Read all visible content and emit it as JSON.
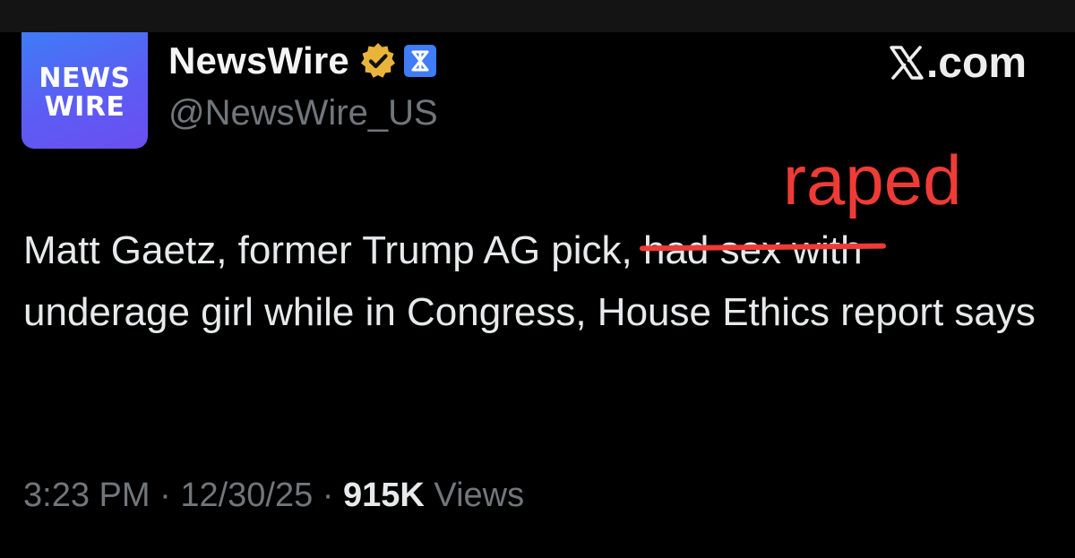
{
  "colors": {
    "background": "#000000",
    "primary_text": "#e7e9ea",
    "secondary_text": "#71767b",
    "annotation_red": "#ef3b36",
    "verified_gold": "#e8b53a",
    "affiliate_blue": "#3f7cf6"
  },
  "avatar": {
    "line1": "NEWS",
    "line2": "WIRE"
  },
  "author": {
    "display_name": "NewsWire",
    "handle": "@NewsWire_US",
    "verified_icon": "gold-verified-badge-icon",
    "affiliate_icon": "affiliate-badge-icon"
  },
  "source": {
    "logo_icon": "x-logo-icon",
    "suffix": ".com"
  },
  "annotation": {
    "replacement_text": "raped"
  },
  "tweet": {
    "text_before": "Matt Gaetz, former Trump AG pick, ",
    "struck_text": "had sex with",
    "text_after": "underage girl while in Congress, House Ethics report says"
  },
  "meta": {
    "time": "3:23 PM",
    "sep1": " · ",
    "date": "12/30/25",
    "sep2": " · ",
    "views_count": "915K",
    "views_label": " Views"
  }
}
